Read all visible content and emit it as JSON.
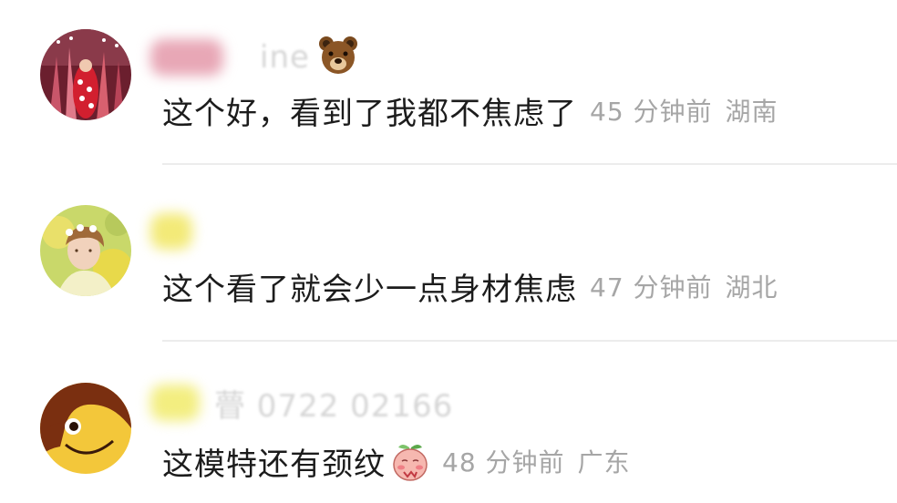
{
  "comments": [
    {
      "username": "ine",
      "name_emoji": "bear-face-icon",
      "text": "这个好，看到了我都不焦虑了",
      "time": "45 分钟前",
      "location": "湖南"
    },
    {
      "username": "",
      "text": "这个看了就会少一点身材焦虑",
      "time": "47 分钟前",
      "location": "湖北"
    },
    {
      "username": "瞢 0722 02166",
      "text": "这模特还有颈纹",
      "inline_emoji": "blushing-peach-icon",
      "time": "48 分钟前",
      "location": "广东"
    }
  ],
  "colors": {
    "meta_text": "#a6a6a6",
    "divider": "#ececec",
    "name_blur_1": "#f2b8c6",
    "name_blur_2": "#f6ef9a",
    "name_blur_3": "#f6f18c"
  }
}
